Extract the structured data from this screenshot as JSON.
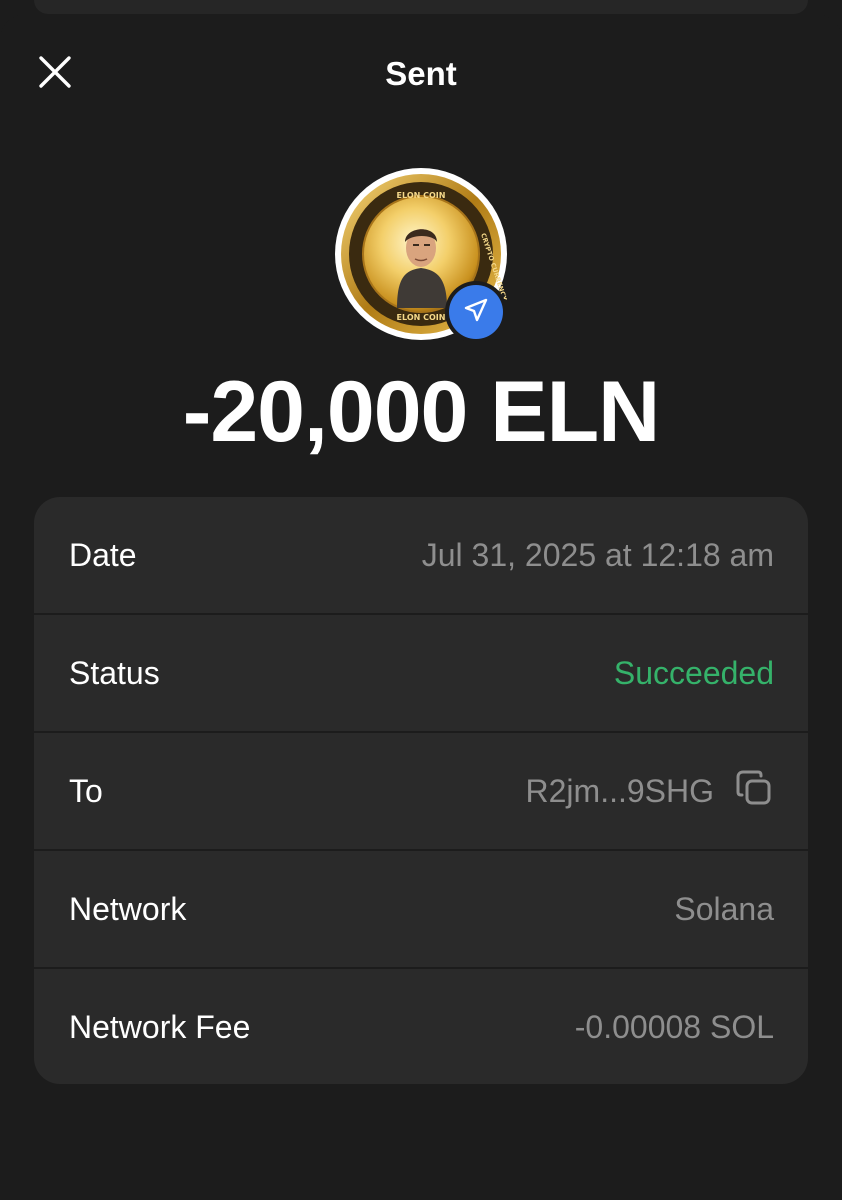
{
  "header": {
    "title": "Sent",
    "close_icon": "close-icon"
  },
  "token": {
    "coin_ring_top_text": "ELON COIN",
    "coin_ring_bottom_text": "ELON COIN",
    "coin_ring_right_text": "CRYPTO CURRENCY",
    "badge_icon": "send-icon"
  },
  "amount": "-20,000 ELN",
  "details": {
    "date": {
      "label": "Date",
      "value": "Jul 31, 2025 at 12:18 am"
    },
    "status": {
      "label": "Status",
      "value": "Succeeded"
    },
    "to": {
      "label": "To",
      "value": "R2jm...9SHG",
      "copy_icon": "copy-icon"
    },
    "network": {
      "label": "Network",
      "value": "Solana"
    },
    "fee": {
      "label": "Network Fee",
      "value": "-0.00008 SOL"
    }
  },
  "colors": {
    "background": "#1c1c1c",
    "card": "#2a2a2a",
    "success": "#35b26a",
    "accent": "#3a7bea",
    "muted_text": "#8e8e8e"
  }
}
